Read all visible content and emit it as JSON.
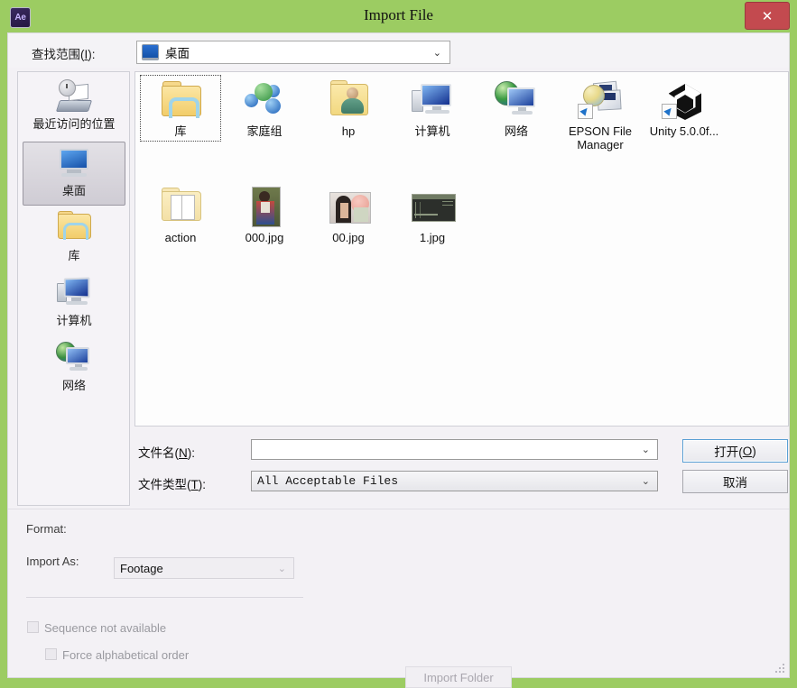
{
  "window": {
    "title": "Import File",
    "app_icon": "Ae",
    "close_label": "✕",
    "frame_color": "#9ccc62",
    "close_color": "#c34a4f"
  },
  "lookin": {
    "label_pre": "查找范围(",
    "label_key": "I",
    "label_post": "):",
    "value": "桌面",
    "caret": "⌄"
  },
  "toolbar": {
    "buttons": [
      {
        "name": "back-button",
        "icon": "back-arrow-icon"
      },
      {
        "name": "up-one-level-button",
        "icon": "up-folder-icon"
      },
      {
        "name": "new-folder-button",
        "icon": "new-folder-icon"
      },
      {
        "name": "views-button",
        "icon": "views-grid-icon"
      }
    ]
  },
  "places": [
    {
      "label": "最近访问的位置",
      "icon": "recent-places-icon",
      "selected": false
    },
    {
      "label": "桌面",
      "icon": "desktop-monitor-icon",
      "selected": true
    },
    {
      "label": "库",
      "icon": "library-folder-icon",
      "selected": false
    },
    {
      "label": "计算机",
      "icon": "computer-icon",
      "selected": false
    },
    {
      "label": "网络",
      "icon": "network-globe-icon",
      "selected": false
    }
  ],
  "files": [
    {
      "label": "库",
      "icon": "library-folder-icon",
      "focused": true
    },
    {
      "label": "家庭组",
      "icon": "homegroup-icon",
      "focused": false
    },
    {
      "label": "hp",
      "icon": "user-folder-icon",
      "focused": false
    },
    {
      "label": "计算机",
      "icon": "computer-icon",
      "focused": false
    },
    {
      "label": "网络",
      "icon": "network-globe-icon",
      "focused": false
    },
    {
      "label": "EPSON File Manager",
      "icon": "epson-file-manager-shortcut-icon",
      "focused": false
    },
    {
      "label": "Unity 5.0.0f...",
      "icon": "unity-shortcut-icon",
      "focused": false
    },
    {
      "label": "action",
      "icon": "plain-folder-icon",
      "focused": false
    },
    {
      "label": "000.jpg",
      "icon": "image-thumbnail-icon",
      "focused": false
    },
    {
      "label": "00.jpg",
      "icon": "image-thumbnail-icon",
      "focused": false
    },
    {
      "label": "1.jpg",
      "icon": "image-thumbnail-icon",
      "focused": false
    }
  ],
  "form": {
    "filename_label_pre": "文件名(",
    "filename_label_key": "N",
    "filename_label_post": "):",
    "filename_value": "",
    "filetype_label_pre": "文件类型(",
    "filetype_label_key": "T",
    "filetype_label_post": "):",
    "filetype_value": "All Acceptable Files",
    "open_pre": "打开(",
    "open_key": "O",
    "open_post": ")",
    "cancel_label": "取消"
  },
  "options": {
    "format_label": "Format:",
    "format_value": "",
    "import_as_label": "Import As:",
    "import_as_value": "Footage",
    "sequence_label": "Sequence not available",
    "force_alpha_label": "Force alphabetical order",
    "import_folder_label": "Import Folder"
  }
}
